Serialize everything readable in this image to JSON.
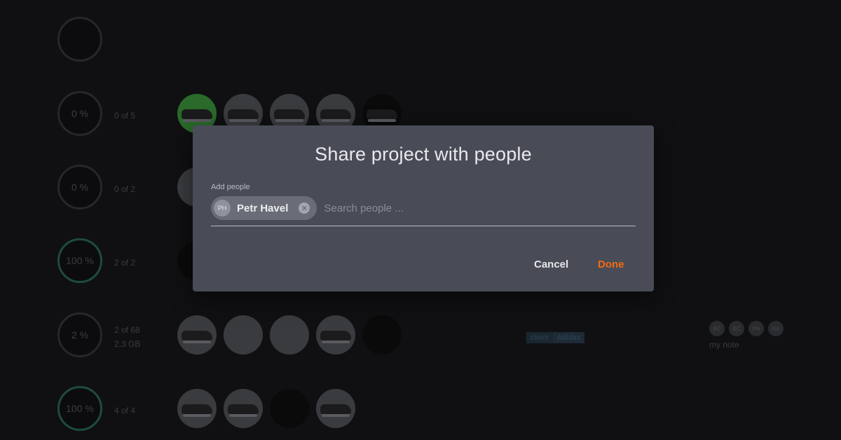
{
  "background": {
    "rows": [
      {
        "progress": "",
        "count": "",
        "size": "",
        "thumbs": []
      },
      {
        "progress": "0 %",
        "count": "0 of 5",
        "size": "",
        "thumbs": [
          "green",
          "shoe",
          "shoe",
          "shoe",
          "dark"
        ]
      },
      {
        "progress": "0 %",
        "count": "0 of 2",
        "size": "",
        "thumbs": [
          "shoe"
        ]
      },
      {
        "progress": "100 %",
        "count": "2 of 2",
        "size": "",
        "thumbs": [
          "dark"
        ]
      },
      {
        "progress": "2 %",
        "count": "2 of 68",
        "size": "2.3 GB",
        "thumbs": [
          "shoe",
          "shoe",
          "film",
          "shoe",
          "dark"
        ],
        "tags": [
          "client",
          "Adidas"
        ],
        "avatars": [
          "BC",
          "BC",
          "PH",
          "RA"
        ],
        "note": "my note"
      },
      {
        "progress": "100 %",
        "count": "4 of 4",
        "size": "",
        "thumbs": [
          "shoe",
          "shoe",
          "statue",
          "shoe"
        ]
      }
    ]
  },
  "dialog": {
    "title": "Share project with people",
    "field_label": "Add people",
    "chip": {
      "initials": "PH",
      "name": "Petr Havel"
    },
    "search_placeholder": "Search people ...",
    "cancel_label": "Cancel",
    "done_label": "Done"
  },
  "colors": {
    "accent": "#f46a12",
    "dialog_bg": "#494c57"
  }
}
